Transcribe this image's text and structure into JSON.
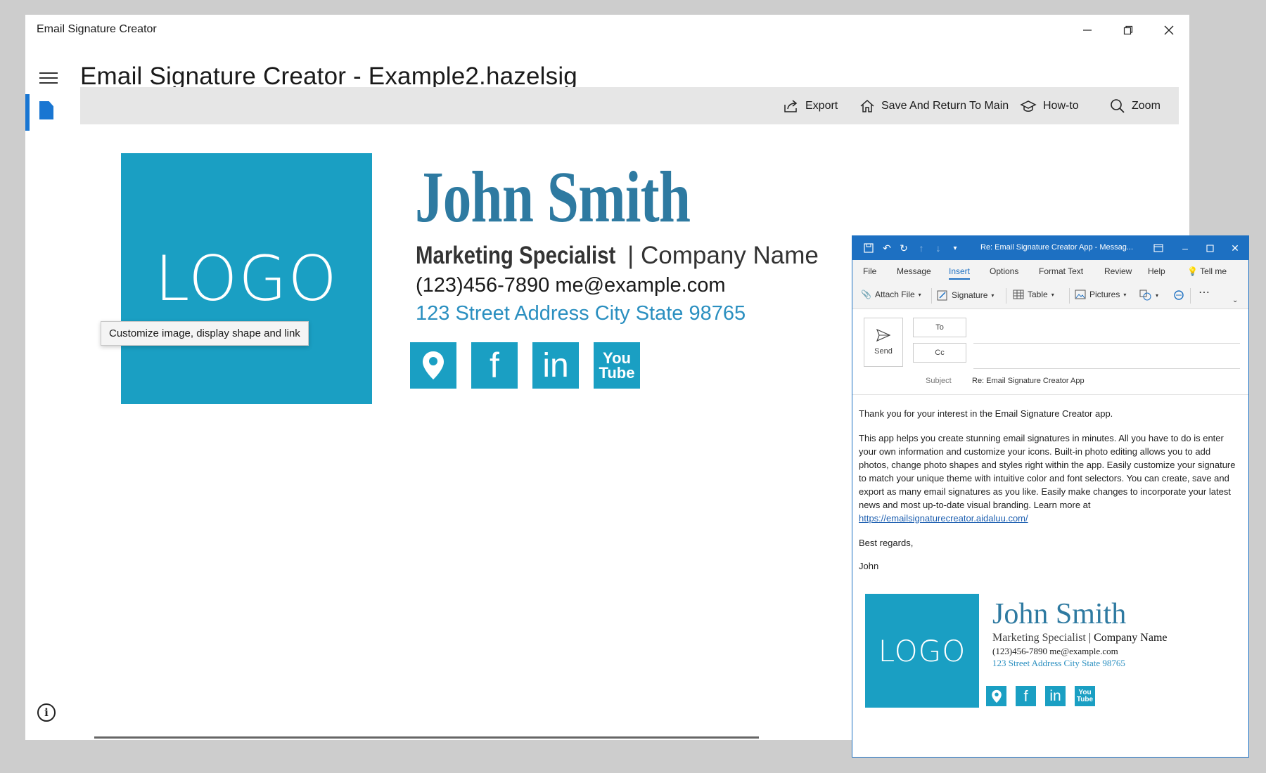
{
  "window": {
    "title": "Email Signature Creator",
    "page_title": "Email Signature Creator - Example2.hazelsig"
  },
  "toolbar": {
    "export": "Export",
    "save_return": "Save And Return To Main",
    "howto": "How-to",
    "zoom": "Zoom"
  },
  "signature": {
    "logo_text": "LOGO",
    "name": "John Smith",
    "role": "Marketing Specialist",
    "separator": " | ",
    "company": "Company Name",
    "contact": "(123)456-7890 me@example.com",
    "address": "123 Street Address City State 98765",
    "tooltip": "Customize image, display shape and link",
    "social": [
      "location-icon",
      "facebook-icon",
      "linkedin-icon",
      "youtube-icon"
    ],
    "facebook_glyph": "f",
    "linkedin_glyph": "in",
    "youtube_glyph_line1": "You",
    "youtube_glyph_line2": "Tube"
  },
  "colors": {
    "brand": "#1a9fc3",
    "name": "#2e7aa1",
    "address": "#2a8fc0",
    "outlook_blue": "#1d70c2",
    "nav_accent": "#1976d2"
  },
  "outlook": {
    "title": "Re: Email Signature Creator App  -  Messag...",
    "menu": [
      "File",
      "Message",
      "Insert",
      "Options",
      "Format Text",
      "Review",
      "Help"
    ],
    "tell_me": "Tell me",
    "ribbon": {
      "attach": "Attach File",
      "signature": "Signature",
      "table": "Table",
      "pictures": "Pictures"
    },
    "send": "Send",
    "to": "To",
    "cc": "Cc",
    "subject_label": "Subject",
    "subject": "Re: Email Signature Creator App",
    "greeting": "Thank you for your interest in the Email Signature Creator app.",
    "paragraph": "This app helps you create stunning email signatures in minutes.  All you have to do is enter your own information and customize your icons.  Built-in photo editing allows you to add photos, change photo shapes and styles right within the app.  Easily customize your signature to match your unique theme with intuitive color and font selectors.  You can create, save and export as many email signatures as you like.  Easily make changes to incorporate your latest news and most up-to-date visual branding.  Learn more at ",
    "link": "https://emailsignaturecreator.aidaluu.com/",
    "regards": "Best regards,",
    "sign_off": "John"
  }
}
